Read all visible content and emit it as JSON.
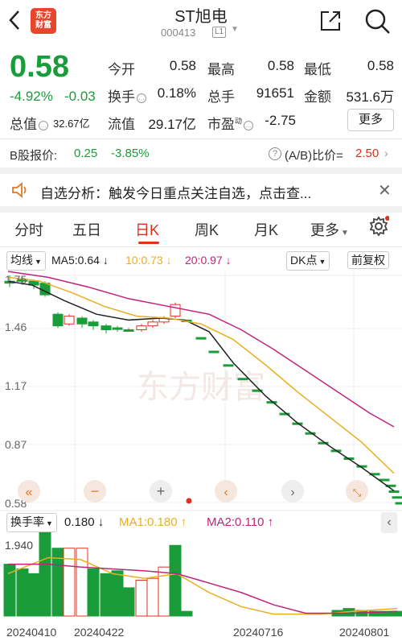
{
  "header": {
    "logo_line1": "东方",
    "logo_line2": "财富",
    "title": "ST旭电",
    "code": "000413",
    "level": "L1"
  },
  "quote": {
    "price": "0.58",
    "change_pct": "-4.92%",
    "change_amt": "-0.03",
    "open_label": "今开",
    "open": "0.58",
    "high_label": "最高",
    "high": "0.58",
    "low_label": "最低",
    "low": "0.58",
    "turnover_label": "换手",
    "turnover": "0.18%",
    "volume_label": "总手",
    "volume": "91651",
    "amount_label": "金额",
    "amount": "531.6万",
    "mktcap_label": "总值",
    "mktcap": "32.67亿",
    "float_label": "流值",
    "float": "29.17亿",
    "pe_label": "市盈",
    "pe_superscript": "动",
    "pe": "-2.75",
    "more_label": "更多"
  },
  "bshare": {
    "label": "B股报价:",
    "price": "0.25",
    "pct": "-3.85%",
    "ratio_label": "(A/B)比价=",
    "ratio": "2.50"
  },
  "notice": {
    "text": "自选分析：触发今日重点关注自选，点击查..."
  },
  "tabs": [
    {
      "label": "分时"
    },
    {
      "label": "五日"
    },
    {
      "label": "日K"
    },
    {
      "label": "周K"
    },
    {
      "label": "月K"
    },
    {
      "label": "更多"
    }
  ],
  "ma_bar": {
    "type_label": "均线",
    "ma5": "MA5:0.64",
    "ma10": "10:0.73",
    "ma20": "20:0.97",
    "dk_label": "DK点",
    "adjust_label": "前复权"
  },
  "price_axis": [
    "1.75",
    "1.46",
    "1.17",
    "0.87",
    "0.58"
  ],
  "watermark": "东方财富",
  "vol_bar": {
    "label": "换手率",
    "value": "0.180",
    "ma1": "MA1:0.180",
    "ma2": "MA2:0.110",
    "axis_top": "1.940"
  },
  "dates": [
    "20240410",
    "20240422",
    "20240716",
    "20240801"
  ],
  "colors": {
    "up": "#e0301e",
    "down": "#1a9c3a",
    "ma5": "#222222",
    "ma10": "#e8b020",
    "ma20": "#c2237a"
  },
  "chart_data": {
    "type": "candlestick",
    "y_ticks": [
      1.75,
      1.46,
      1.17,
      0.87,
      0.58
    ],
    "ma_latest": {
      "MA5": 0.64,
      "MA10": 0.73,
      "MA20": 0.97
    },
    "turnover_latest": 0.18,
    "turnover_ma1": 0.18,
    "turnover_ma2": 0.11,
    "turnover_axis_max": 1.94
  }
}
